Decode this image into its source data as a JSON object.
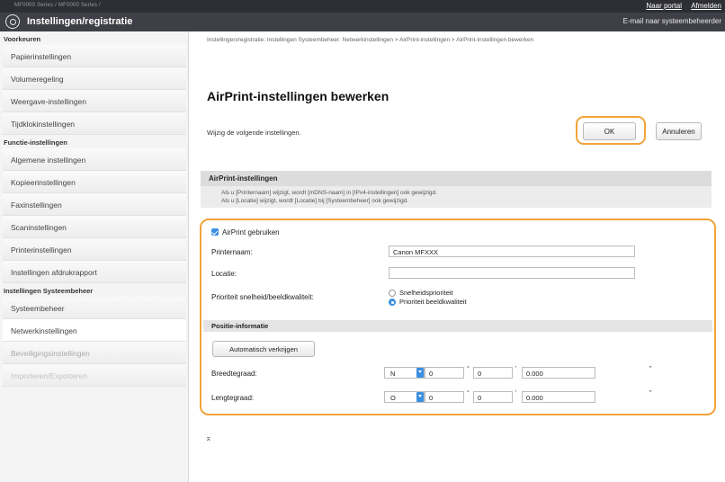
{
  "topbar": {
    "model": "MF0000 Series / MF0000 Series /",
    "portal_link": "Naar portal",
    "logout_link": "Afmelden"
  },
  "header": {
    "title": "Instellingen/registratie",
    "email_link": "E-mail naar systeembeheerder"
  },
  "sidebar": {
    "sections": [
      {
        "title": "Voorkeuren",
        "items": [
          "Papierinstellingen",
          "Volumeregeling",
          "Weergave-instellingen",
          "Tijdklokinstellingen"
        ]
      },
      {
        "title": "Functie-instellingen",
        "items": [
          "Algemene instellingen",
          "Kopieerinstellingen",
          "Faxinstellingen",
          "Scaninstellingen",
          "Printerinstellingen",
          "Instellingen afdrukrapport"
        ]
      },
      {
        "title": "Instellingen Systeembeheer",
        "items": [
          "Systeembeheer",
          "Netwerkinstellingen",
          "Beveiligingsinstellingen",
          "Importeren/Exporteren"
        ]
      }
    ]
  },
  "main": {
    "breadcrumb": "Instellingen/registratie: Instellingen Systeembeheer: Netwerkinstellingen > AirPrint-instellingen > AirPrint-instellingen bewerken",
    "title": "AirPrint-instellingen bewerken",
    "hint": "Wijzig de volgende instellingen.",
    "ok_label": "OK",
    "cancel_label": "Annuleren",
    "section_title": "AirPrint-instellingen",
    "note_line1": "Als u [Printernaam] wijzigt, wordt [mDNS-naam] in [IPv4-instellingen] ook gewijzigd.",
    "note_line2": "Als u [Locatie] wijzigt, wordt [Locatie] bij [Systeembeheer] ook gewijzigd.",
    "use_airprint_label": "AirPrint gebruiken",
    "use_airprint_checked": true,
    "printer_name_label": "Printernaam:",
    "printer_name_value": "Canon MFXXX",
    "location_label": "Locatie:",
    "location_value": "",
    "priority_label": "Prioriteit snelheid/beeldkwaliteit:",
    "priority_options": [
      "Snelheidsprioriteit",
      "Prioriteit beeldkwaliteit"
    ],
    "priority_selected": "Prioriteit beeldkwaliteit",
    "position_section": "Positie-informatie",
    "auto_button": "Automatisch verkrijgen",
    "latitude_label": "Breedtegraad:",
    "latitude": {
      "dir": "N",
      "deg": "0",
      "min": "0",
      "sec": "0.000"
    },
    "longitude_label": "Lengtegraad:",
    "longitude": {
      "dir": "O",
      "deg": "0",
      "min": "0",
      "sec": "0.000"
    },
    "back_to_top": "⌅"
  },
  "colors": {
    "highlight": "#f2a33a",
    "accent": "#3b8ee0",
    "header": "#3f4047",
    "topbar": "#2e2f35"
  }
}
